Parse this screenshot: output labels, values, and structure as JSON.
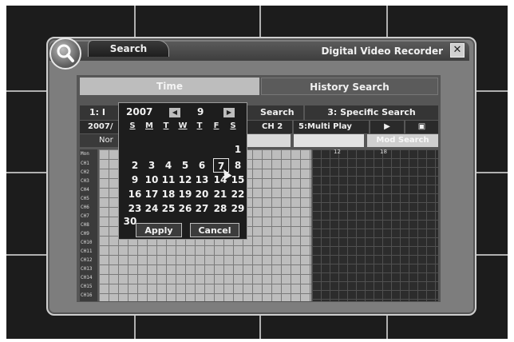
{
  "window": {
    "tab_label": "Search",
    "title": "Digital Video Recorder",
    "close_icon": "close-icon",
    "search_icon": "magnifier-icon"
  },
  "tabs": {
    "time": "Time",
    "history": "History Search"
  },
  "search_modes": {
    "mode1": "1: I",
    "mode2": "Search",
    "mode3": "3: Specific Search"
  },
  "controls": {
    "date_fragment": "2007/",
    "channel_fragment": "CH 2",
    "multi_play": "5:Multi Play",
    "play_icon": "play-icon",
    "grid_icon": "grid-icon"
  },
  "row3": {
    "normal_fragment": "Nor",
    "mode_button": "Mod Search"
  },
  "grid": {
    "header_label": "Mon",
    "channel_labels": [
      "CH1",
      "CH2",
      "CH3",
      "CH4",
      "CH5",
      "CH6",
      "CH7",
      "CH8",
      "CH9",
      "CH10",
      "CH11",
      "CH12",
      "CH13",
      "CH14",
      "CH15",
      "CH16"
    ],
    "hour_labels": [
      "12",
      "18"
    ]
  },
  "calendar": {
    "year": "2007",
    "month": "9",
    "prev_icon": "prev-icon",
    "next_icon": "next-icon",
    "weekdays": [
      "S",
      "M",
      "T",
      "W",
      "T",
      "F",
      "S"
    ],
    "days": [
      "1",
      "2",
      "3",
      "4",
      "5",
      "6",
      "7",
      "8",
      "9",
      "10",
      "11",
      "12",
      "13",
      "14",
      "15",
      "16",
      "17",
      "18",
      "19",
      "20",
      "21",
      "22",
      "23",
      "24",
      "25",
      "26",
      "27",
      "28",
      "29",
      "30"
    ],
    "selected_day": "7",
    "apply_label": "Apply",
    "cancel_label": "Cancel"
  },
  "colors": {
    "panel": "#7d7d7d",
    "dark": "#1d1d1d",
    "grid_light": "#bdbdbd",
    "grid_dark": "#2c2c2c"
  }
}
